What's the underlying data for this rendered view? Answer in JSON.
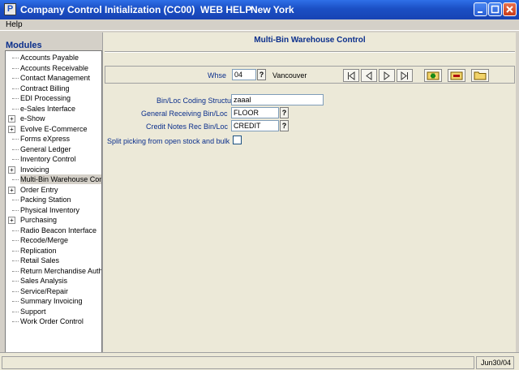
{
  "window": {
    "title": "Company Control Initialization (CC00)",
    "help_link": "WEB HELP",
    "location": "New York",
    "icon_letter": "P"
  },
  "menu": {
    "help": "Help"
  },
  "sidebar": {
    "header": "Modules",
    "items": [
      {
        "label": "Accounts Payable",
        "expandable": false
      },
      {
        "label": "Accounts Receivable",
        "expandable": false
      },
      {
        "label": "Contact Management",
        "expandable": false
      },
      {
        "label": "Contract Billing",
        "expandable": false
      },
      {
        "label": "EDI Processing",
        "expandable": false
      },
      {
        "label": "e-Sales Interface",
        "expandable": false
      },
      {
        "label": "e-Show",
        "expandable": true
      },
      {
        "label": "Evolve E-Commerce",
        "expandable": true
      },
      {
        "label": "Forms eXpress",
        "expandable": false
      },
      {
        "label": "General Ledger",
        "expandable": false
      },
      {
        "label": "Inventory Control",
        "expandable": false
      },
      {
        "label": "Invoicing",
        "expandable": true
      },
      {
        "label": "Multi-Bin Warehouse Con",
        "expandable": false,
        "selected": true
      },
      {
        "label": "Order Entry",
        "expandable": true
      },
      {
        "label": "Packing Station",
        "expandable": false
      },
      {
        "label": "Physical Inventory",
        "expandable": false
      },
      {
        "label": "Purchasing",
        "expandable": true
      },
      {
        "label": "Radio Beacon Interface",
        "expandable": false
      },
      {
        "label": "Recode/Merge",
        "expandable": false
      },
      {
        "label": "Replication",
        "expandable": false
      },
      {
        "label": "Retail Sales",
        "expandable": false
      },
      {
        "label": "Return Merchandise Auth",
        "expandable": false
      },
      {
        "label": "Sales Analysis",
        "expandable": false
      },
      {
        "label": "Service/Repair",
        "expandable": false
      },
      {
        "label": "Summary Invoicing",
        "expandable": false
      },
      {
        "label": "Support",
        "expandable": false
      },
      {
        "label": "Work Order Control",
        "expandable": false
      }
    ]
  },
  "main": {
    "title": "Multi-Bin Warehouse Control",
    "whse_label": "Whse",
    "whse_value": "04",
    "whse_name": "Vancouver",
    "lookup": "?",
    "fields": {
      "bin_coding_label": "Bin/Loc Coding Structure",
      "bin_coding_value": "zaaal",
      "gen_recv_label": "General Receiving Bin/Loc",
      "gen_recv_value": "FLOOR",
      "credit_notes_label": "Credit Notes Rec Bin/Loc",
      "credit_notes_value": "CREDIT",
      "split_picking_label": "Split picking from open stock and bulk",
      "split_picking_checked": false
    }
  },
  "status": {
    "date": "Jun30/04"
  },
  "colors": {
    "title_bar": "#1b4fc4",
    "label_blue": "#0b2f8c",
    "panel_bg": "#ece9d8"
  }
}
